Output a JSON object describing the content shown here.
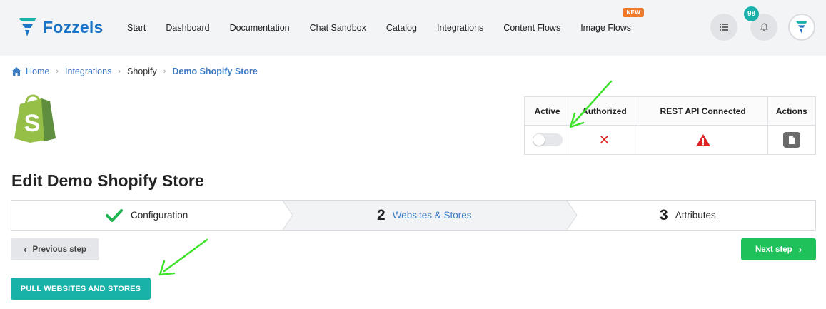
{
  "header": {
    "brand": "Fozzels",
    "nav": [
      {
        "label": "Start"
      },
      {
        "label": "Dashboard"
      },
      {
        "label": "Documentation"
      },
      {
        "label": "Chat Sandbox"
      },
      {
        "label": "Catalog"
      },
      {
        "label": "Integrations"
      },
      {
        "label": "Content Flows"
      },
      {
        "label": "Image Flows",
        "badge": "NEW"
      }
    ],
    "notification_count": "98",
    "icons": [
      "list-icon",
      "bell-icon",
      "brand-avatar-icon"
    ],
    "colors": {
      "brand": "#1b74c5",
      "badge": "#f07a2c",
      "count": "#19b1a9"
    }
  },
  "breadcrumb": {
    "home": "Home",
    "items": [
      "Integrations",
      "Shopify"
    ],
    "current": "Demo Shopify Store"
  },
  "status_table": {
    "headers": [
      "Active",
      "Authorized",
      "REST API Connected",
      "Actions"
    ],
    "active": false,
    "authorized_symbol": "✕",
    "icons": [
      "toggle",
      "x-icon",
      "warning-icon",
      "document-icon"
    ]
  },
  "page": {
    "title": "Edit Demo Shopify Store"
  },
  "steps": [
    {
      "label": "Configuration",
      "state": "done"
    },
    {
      "number": "2",
      "label": "Websites & Stores",
      "state": "active"
    },
    {
      "number": "3",
      "label": "Attributes",
      "state": "pending"
    }
  ],
  "buttons": {
    "previous": "Previous step",
    "next": "Next step",
    "pull": "PULL WEBSITES AND STORES"
  },
  "colors": {
    "next_button": "#1fc25a",
    "pull_button": "#19b2a8",
    "annotation_arrow": "#3ee22b",
    "error": "#e02424"
  }
}
